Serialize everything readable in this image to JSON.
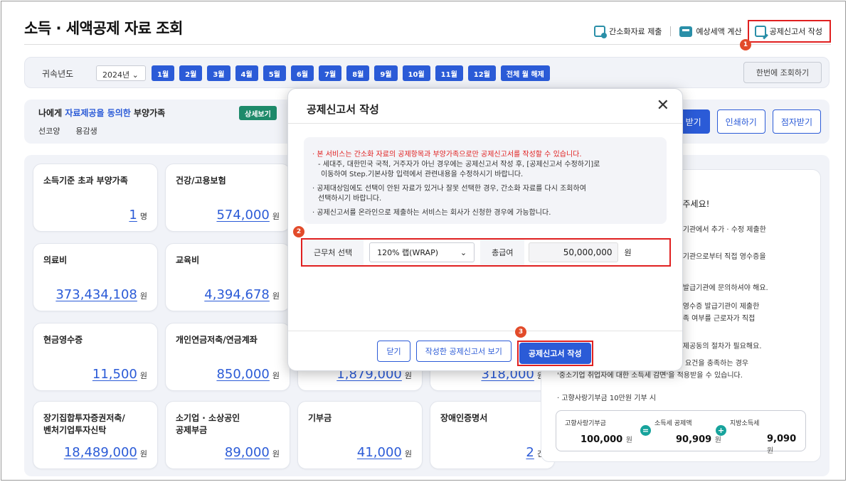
{
  "page": {
    "title": "소득 · 세액공제 자료 조회"
  },
  "header_links": [
    {
      "label": "간소화자료 제출",
      "icon": "doc-submit-icon"
    },
    {
      "label": "예상세액 계산",
      "icon": "calculator-icon"
    },
    {
      "label": "공제신고서 작성",
      "icon": "pen-doc-icon"
    }
  ],
  "markers": [
    "1",
    "2",
    "3"
  ],
  "year_bar": {
    "label": "귀속년도",
    "selected_year": "2024년",
    "months": [
      "1월",
      "2월",
      "3월",
      "4월",
      "5월",
      "6월",
      "7월",
      "8월",
      "9월",
      "10월",
      "11월",
      "12월",
      "전체 월 해제"
    ],
    "query_once": "한번에 조회하기"
  },
  "dependents": {
    "title_prefix": "나에게 ",
    "title_accent": "자료제공을 동의한",
    "title_suffix": " 부양가족",
    "names": [
      "선코양",
      "용감생"
    ],
    "detail_button": "상세보기",
    "buttons": [
      "받기",
      "인쇄하기",
      "점자받기"
    ]
  },
  "cards": [
    {
      "label": "소득기준 초과 부양가족",
      "value": "1",
      "unit": "명"
    },
    {
      "label": "건강/고용보험",
      "value": "574,000",
      "unit": "원"
    },
    {
      "label": "의료비",
      "value": "373,434,108",
      "unit": "원"
    },
    {
      "label": "교육비",
      "value": "4,394,678",
      "unit": "원"
    },
    {
      "label": "현금영수증",
      "value": "11,500",
      "unit": "원"
    },
    {
      "label": "개인연금저축/연금계좌",
      "value": "850,000",
      "unit": "원"
    },
    {
      "label": "",
      "value": "1,879,000",
      "unit": "원"
    },
    {
      "label": "",
      "value": "318,000",
      "unit": "원"
    },
    {
      "label": "장기집합투자증권저축/\n벤처기업투자신탁",
      "value": "18,489,000",
      "unit": "원"
    },
    {
      "label": "소기업 · 소상공인\n공제부금",
      "value": "89,000",
      "unit": "원"
    },
    {
      "label": "기부금",
      "value": "41,000",
      "unit": "원"
    },
    {
      "label": "장애인증명서",
      "value": "2",
      "unit": "건"
    }
  ],
  "right_panel": {
    "head_big": "인",
    "head_rest": "해 주세요!",
    "lines": [
      "증 발급기관에서 추가 · 수정 제출한",
      "증 발급기관으로부터 직접 영수증을",
      "요.",
      "영수증 발급기관에 문의하셔야 해요.",
      "자료는 영수증 발급기관이 제출한",
      "요건 충족 여부를 근로자가 직접",
      "는 자료제공동의 절차가 필요해요.",
      "서 일정 요건을 충족하는 경우",
      "'중소기업 취업자에 대한 소득세 감면'을 적용받을 수 있습니다."
    ],
    "bullet": "· 고향사랑기부금 10만원 기부 시",
    "calc": {
      "c1_label": "고향사랑기부금",
      "c1_value": "100,000",
      "c1_unit": "원",
      "op1": "=",
      "c2_label": "소득세 공제액",
      "c2_value": "90,909",
      "c2_unit": "원",
      "op2": "+",
      "c3_label": "지방소득세",
      "c3_value": "9,090",
      "c3_unit": "원"
    }
  },
  "modal": {
    "title": "공제신고서 작성",
    "close": "✕",
    "notice": [
      "· 본 서비스는 간소화 자료의 공제항목과 부양가족으로만 공제신고서를 작성할 수 있습니다.",
      "- 세대주, 대한민국 국적, 거주자가 아닌 경우에는 공제신고서 작성 후, [공제신고서 수정하기]로",
      "이동하여 Step.기본사항 입력에서 관련내용을 수정하시기 바랍니다.",
      "· 공제대상임에도 선택이 안된 자료가 있거나 잘못 선택한 경우, 간소화 자료를 다시 조회하여",
      "선택하시기 바랍니다.",
      "· 공제신고서를 온라인으로 제출하는 서비스는 회사가 신청한 경우에 가능합니다."
    ],
    "workplace_label": "근무처 선택",
    "workplace_value": "120% 랩(WRAP)",
    "salary_label": "총급여",
    "salary_value": "50,000,000",
    "salary_unit": "원",
    "btn_close": "닫기",
    "btn_view": "작성한 공제신고서 보기",
    "btn_write": "공제신고서 작성"
  }
}
